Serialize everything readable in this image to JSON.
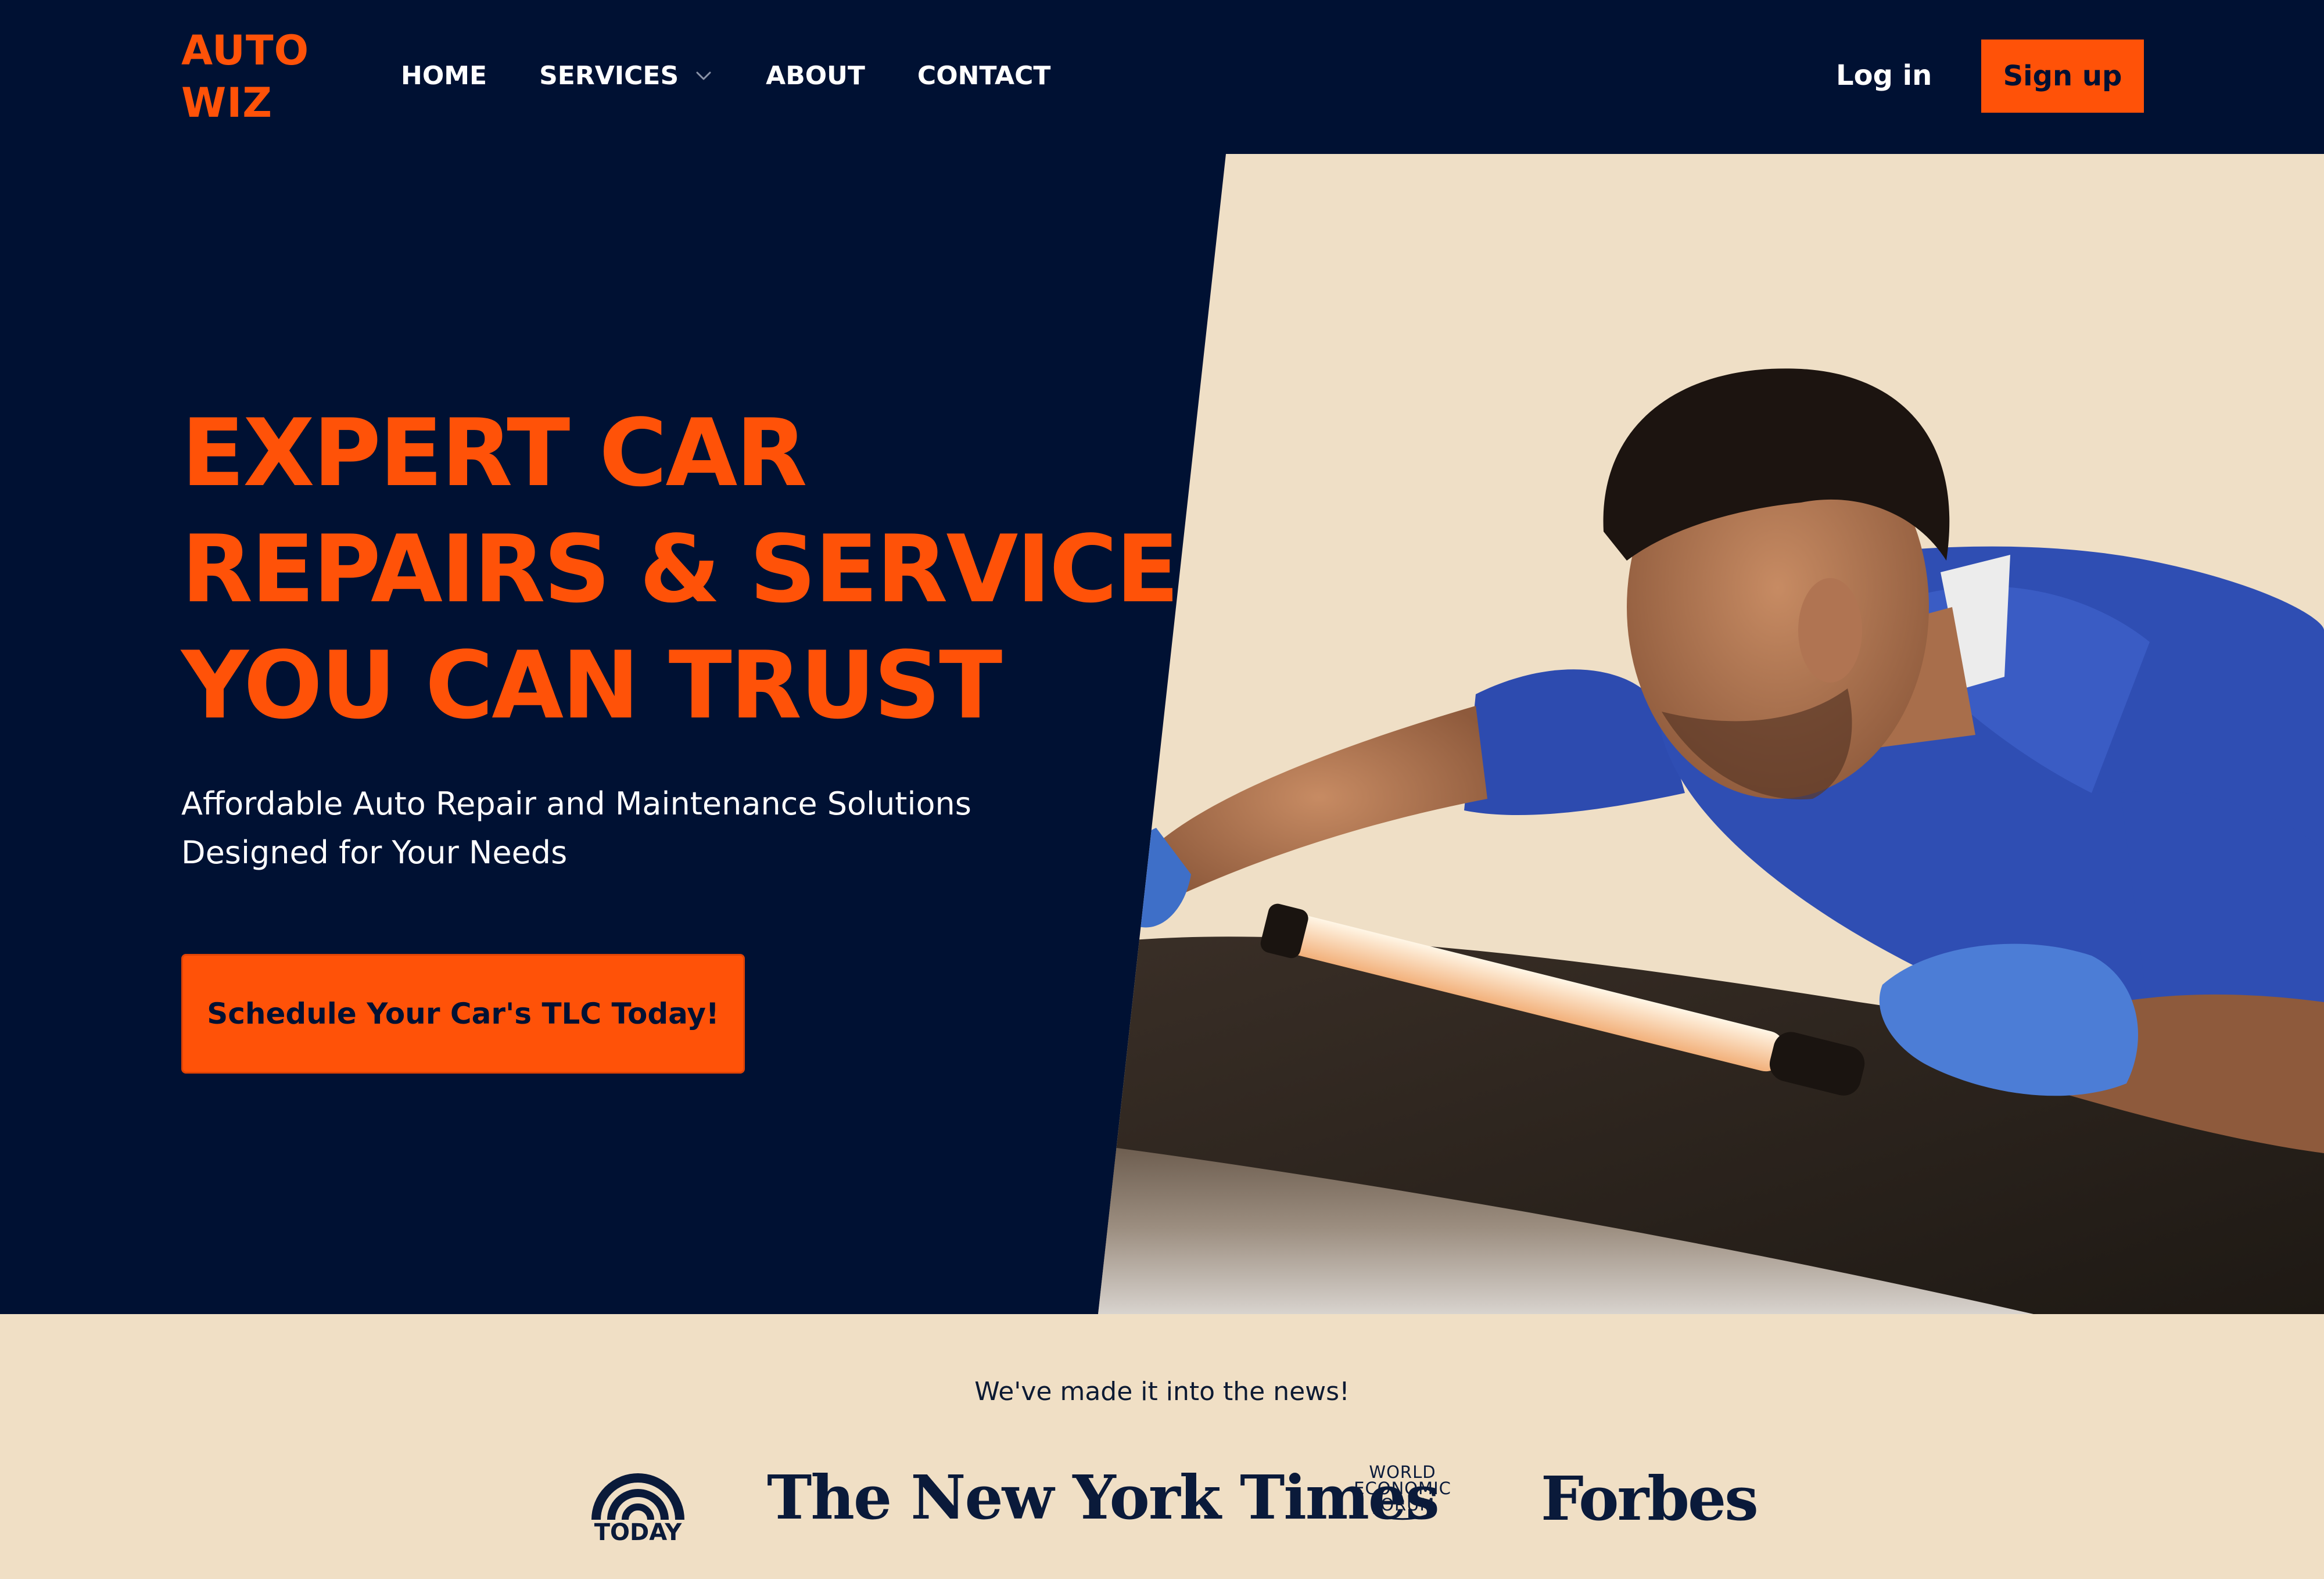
{
  "brand": {
    "line1": "AUTO",
    "line2": "WIZ",
    "accent_color": "#FF5208",
    "navy_color": "#001133",
    "cream_color": "#F0DFC5"
  },
  "nav": {
    "items": [
      {
        "label": "HOME"
      },
      {
        "label": "SERVICES",
        "icon": "chevron-down-icon"
      },
      {
        "label": "ABOUT"
      },
      {
        "label": "CONTACT"
      }
    ],
    "login_label": "Log in",
    "signup_label": "Sign up"
  },
  "hero": {
    "title_lines": [
      "EXPERT CAR",
      "REPAIRS & SERVICE",
      "YOU CAN TRUST"
    ],
    "subtitle_lines": [
      "Affordable Auto Repair and Maintenance Solutions",
      "Designed for Your Needs"
    ],
    "cta_label": "Schedule Your Car's TLC Today!",
    "image_subject": "mechanic-inspecting-car-engine"
  },
  "press": {
    "heading": "We've made it into the news!",
    "logos": [
      {
        "name": "TODAY",
        "text": "TODAY"
      },
      {
        "name": "The New York Times",
        "text": "The New York Times"
      },
      {
        "name": "World Economic Forum",
        "lines": [
          "WORLD",
          "ECONOMIC",
          "FORUM"
        ]
      },
      {
        "name": "Forbes",
        "text": "Forbes"
      }
    ]
  }
}
